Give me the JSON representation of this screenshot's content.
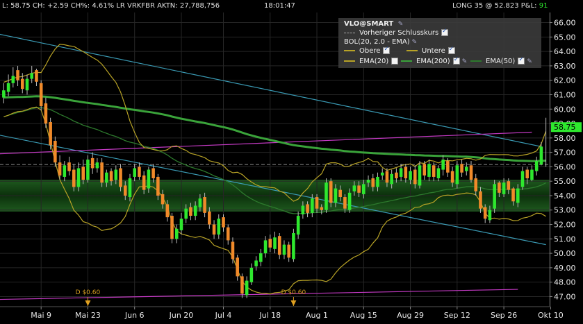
{
  "topbar": {
    "last": "L: 58.75 CH: +2.59 CH%: 4.61% LR VRKFBR AKTN: 27,788,756",
    "time": "18:01:47",
    "position_prefix": "LONG 35 @ 52.823 P&L:",
    "pnl": "91"
  },
  "legend": {
    "symbol": "VLO@SMART",
    "prev_close": "Vorheriger Schlusskurs",
    "bol": "BOL(20, 2.0 - EMA)",
    "upper": "Obere",
    "lower": "Untere",
    "ema20": "EMA(20)",
    "ema200": "EMA(200)",
    "ema50": "EMA(50)",
    "wrench_icon": "wrench-icon"
  },
  "colors": {
    "up": "#2ee82e",
    "down": "#f08a2a",
    "bollinger": "#b8a326",
    "ema20": "#5a9a2a",
    "ema200": "#3aa33a",
    "ema50": "#2d7a2d",
    "trend_blue": "#3a9ab4",
    "trend_magenta": "#c43ac4",
    "zone": "#0f3a0f",
    "price_tag": "#2ee82e"
  },
  "chart_data": {
    "type": "candlestick",
    "ylim": [
      46.3,
      66.7
    ],
    "y_ticks": [
      "47.00",
      "48.00",
      "49.00",
      "50.00",
      "51.00",
      "52.00",
      "53.00",
      "54.00",
      "55.00",
      "56.00",
      "57.00",
      "58.00",
      "59.00",
      "60.00",
      "61.00",
      "62.00",
      "63.00",
      "64.00",
      "65.00",
      "66.00"
    ],
    "x_ticks": [
      {
        "label": "Mai 9",
        "i": 8
      },
      {
        "label": "Mai 23",
        "i": 18
      },
      {
        "label": "Jun 6",
        "i": 28
      },
      {
        "label": "Jun 20",
        "i": 38
      },
      {
        "label": "Jul 4",
        "i": 47
      },
      {
        "label": "Jul 18",
        "i": 57
      },
      {
        "label": "Aug 1",
        "i": 67
      },
      {
        "label": "Aug 15",
        "i": 77
      },
      {
        "label": "Aug 29",
        "i": 87
      },
      {
        "label": "Sep 12",
        "i": 97
      },
      {
        "label": "Sep 26",
        "i": 107
      },
      {
        "label": "Okt 10",
        "i": 117
      }
    ],
    "dividends": [
      {
        "label": "D $0.60",
        "i": 18
      },
      {
        "label": "D $0.60",
        "i": 62
      }
    ],
    "last_price": "58.75",
    "prev_close_level": 56.16,
    "support_zone": [
      52.9,
      55.1
    ],
    "closes": [
      61.3,
      61.8,
      62.3,
      62.0,
      61.4,
      62.1,
      62.5,
      61.9,
      60.2,
      59.0,
      57.5,
      56.3,
      55.4,
      56.1,
      55.7,
      54.6,
      55.9,
      55.1,
      56.5,
      55.9,
      56.3,
      54.9,
      55.6,
      55.0,
      55.8,
      54.6,
      54.0,
      55.2,
      55.9,
      55.3,
      54.4,
      55.8,
      55.2,
      54.0,
      53.4,
      52.5,
      51.0,
      51.7,
      52.4,
      53.1,
      52.6,
      53.3,
      53.8,
      52.8,
      52.0,
      51.3,
      52.4,
      51.8,
      50.9,
      49.6,
      48.4,
      47.2,
      48.1,
      49.0,
      49.5,
      50.0,
      50.9,
      50.4,
      51.1,
      49.9,
      50.6,
      49.7,
      51.4,
      52.6,
      53.3,
      52.8,
      53.8,
      53.1,
      53.0,
      54.9,
      53.5,
      54.5,
      53.9,
      53.1,
      54.2,
      54.7,
      54.2,
      54.8,
      55.1,
      54.6,
      55.3,
      55.6,
      54.9,
      55.5,
      55.2,
      55.9,
      55.2,
      55.7,
      54.8,
      56.1,
      55.4,
      56.2,
      55.3,
      55.9,
      56.5,
      55.6,
      54.9,
      56.1,
      55.6,
      56.0,
      55.1,
      54.3,
      53.1,
      52.4,
      53.0,
      54.8,
      54.2,
      54.9,
      54.4,
      53.6,
      54.5,
      55.7,
      55.2,
      55.8,
      56.4,
      57.4,
      58.75
    ],
    "opens": [
      60.8,
      61.2,
      61.8,
      62.7,
      62.1,
      61.3,
      62.1,
      62.7,
      61.8,
      60.4,
      59.1,
      57.8,
      56.3,
      55.3,
      56.3,
      55.8,
      54.6,
      56.0,
      55.1,
      56.6,
      55.9,
      56.3,
      54.9,
      55.7,
      55.1,
      55.9,
      54.7,
      53.9,
      55.3,
      56.0,
      55.4,
      54.5,
      55.9,
      55.3,
      54.1,
      53.4,
      52.6,
      51.0,
      51.6,
      52.4,
      53.2,
      52.6,
      53.2,
      53.9,
      52.9,
      52.0,
      51.3,
      52.5,
      51.8,
      50.8,
      49.7,
      48.4,
      47.1,
      48.0,
      49.1,
      49.4,
      50.0,
      51.0,
      50.3,
      51.2,
      49.9,
      50.6,
      49.6,
      51.3,
      52.7,
      53.4,
      52.8,
      53.9,
      53.2,
      53.0,
      55.0,
      53.5,
      54.4,
      53.9,
      53.0,
      54.3,
      54.7,
      54.1,
      54.9,
      55.2,
      54.6,
      55.4,
      55.7,
      54.8,
      55.6,
      55.3,
      56.0,
      55.1,
      55.8,
      54.7,
      56.2,
      55.3,
      56.1,
      55.2,
      55.8,
      56.4,
      55.7,
      54.8,
      56.2,
      55.7,
      56.1,
      55.2,
      54.3,
      53.2,
      52.3,
      53.1,
      54.9,
      54.1,
      55.0,
      54.5,
      53.5,
      54.6,
      55.8,
      55.1,
      55.7,
      56.16
    ],
    "highs": [
      61.8,
      62.4,
      62.9,
      63.0,
      62.5,
      62.4,
      63.0,
      62.8,
      62.0,
      60.8,
      59.4,
      58.1,
      56.8,
      56.4,
      56.7,
      56.2,
      56.3,
      56.5,
      56.8,
      57.0,
      56.6,
      56.6,
      55.8,
      55.9,
      56.1,
      56.2,
      55.0,
      55.5,
      56.2,
      56.3,
      55.7,
      56.0,
      56.2,
      55.5,
      54.4,
      53.7,
      52.8,
      52.0,
      52.8,
      53.4,
      53.5,
      53.6,
      54.1,
      54.2,
      53.2,
      52.3,
      52.7,
      52.7,
      52.0,
      51.1,
      49.9,
      48.6,
      48.4,
      49.3,
      49.8,
      50.3,
      51.2,
      51.3,
      51.5,
      51.4,
      50.9,
      50.8,
      51.7,
      52.9,
      53.6,
      53.6,
      54.1,
      54.1,
      53.4,
      55.2,
      55.2,
      54.8,
      54.7,
      54.1,
      54.5,
      55.0,
      55.0,
      55.1,
      55.4,
      55.5,
      55.6,
      55.9,
      55.9,
      55.8,
      55.9,
      56.2,
      56.2,
      56.0,
      56.1,
      56.4,
      56.4,
      56.5,
      56.3,
      56.1,
      56.8,
      56.6,
      56.0,
      56.4,
      56.5,
      56.3,
      56.4,
      55.5,
      54.6,
      53.4,
      53.3,
      55.1,
      55.0,
      55.2,
      55.2,
      54.6,
      54.8,
      56.0,
      56.0,
      56.1,
      56.7,
      57.7,
      59.4
    ],
    "lows": [
      60.4,
      60.9,
      61.5,
      61.6,
      61.1,
      61.0,
      61.8,
      61.6,
      59.9,
      58.7,
      57.2,
      56.0,
      55.1,
      55.0,
      55.4,
      54.3,
      54.3,
      54.8,
      54.9,
      55.5,
      55.6,
      54.6,
      54.6,
      54.7,
      54.8,
      54.3,
      53.7,
      53.6,
      55.0,
      55.1,
      54.1,
      54.2,
      54.9,
      53.7,
      53.1,
      52.2,
      50.7,
      50.7,
      51.3,
      52.1,
      52.3,
      52.3,
      52.9,
      52.5,
      51.7,
      51.0,
      51.0,
      51.5,
      50.6,
      49.3,
      48.1,
      46.9,
      46.9,
      47.8,
      48.8,
      49.1,
      49.7,
      50.1,
      50.0,
      49.6,
      49.6,
      49.4,
      49.4,
      51.0,
      52.4,
      52.5,
      52.5,
      52.8,
      52.7,
      52.8,
      53.2,
      53.2,
      53.6,
      52.8,
      52.8,
      54.0,
      53.9,
      53.8,
      54.6,
      54.3,
      54.3,
      55.1,
      54.6,
      54.5,
      54.9,
      55.0,
      54.9,
      54.8,
      54.5,
      54.5,
      55.1,
      55.0,
      55.0,
      55.0,
      55.4,
      55.3,
      54.6,
      54.5,
      55.3,
      55.4,
      54.9,
      54.0,
      52.8,
      52.1,
      52.1,
      52.8,
      53.9,
      53.9,
      54.1,
      53.3,
      53.2,
      54.4,
      54.8,
      55.0,
      55.4,
      56.1,
      56.0
    ]
  }
}
